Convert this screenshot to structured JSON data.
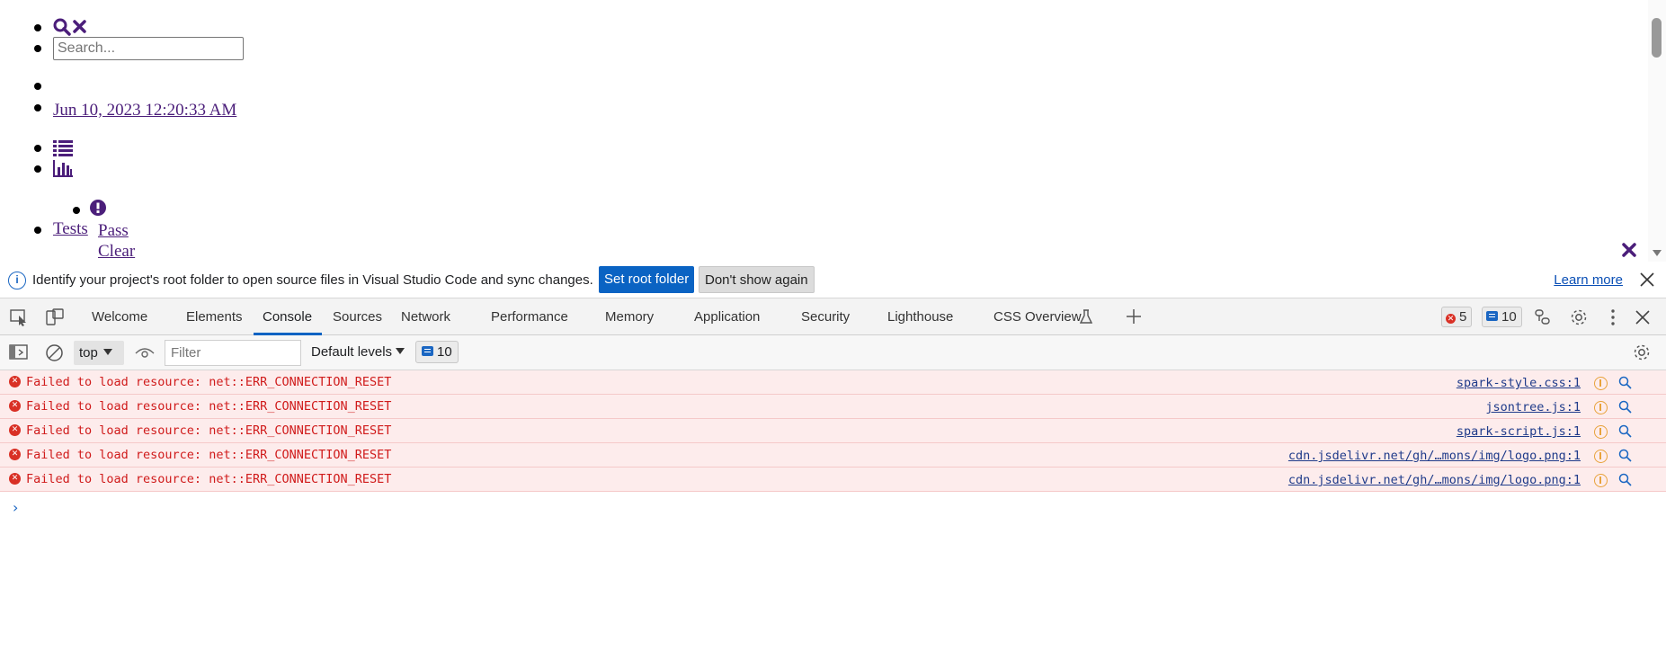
{
  "page": {
    "search_placeholder": "Search...",
    "timestamp_link": "Jun 10, 2023 12:20:33 AM",
    "tests_link": "Tests",
    "pass_link": "Pass",
    "clear_link": "Clear"
  },
  "infobar": {
    "message": "Identify your project's root folder to open source files in Visual Studio Code and sync changes.",
    "set_root_label": "Set root folder",
    "dont_show_label": "Don't show again",
    "learn_more_label": "Learn more"
  },
  "devtools": {
    "tabs": [
      {
        "label": "Welcome"
      },
      {
        "label": "Elements"
      },
      {
        "label": "Console"
      },
      {
        "label": "Sources"
      },
      {
        "label": "Network"
      },
      {
        "label": "Performance"
      },
      {
        "label": "Memory"
      },
      {
        "label": "Application"
      },
      {
        "label": "Security"
      },
      {
        "label": "Lighthouse"
      },
      {
        "label": "CSS Overview"
      }
    ],
    "error_count": "5",
    "message_count": "10"
  },
  "console_toolbar": {
    "context": "top",
    "filter_placeholder": "Filter",
    "levels_label": "Default levels",
    "issues_count": "10"
  },
  "messages": [
    {
      "text": "Failed to load resource: net::ERR_CONNECTION_RESET",
      "source": "spark-style.css:1"
    },
    {
      "text": "Failed to load resource: net::ERR_CONNECTION_RESET",
      "source": "jsontree.js:1"
    },
    {
      "text": "Failed to load resource: net::ERR_CONNECTION_RESET",
      "source": "spark-script.js:1"
    },
    {
      "text": "Failed to load resource: net::ERR_CONNECTION_RESET",
      "source": "cdn.jsdelivr.net/gh/…mons/img/logo.png:1"
    },
    {
      "text": "Failed to load resource: net::ERR_CONNECTION_RESET",
      "source": "cdn.jsdelivr.net/gh/…mons/img/logo.png:1"
    }
  ],
  "colors": {
    "accent": "#0a63c3",
    "page_link": "#4b1e7a",
    "error_text": "#d01b1b",
    "error_bg": "#fdecec"
  }
}
